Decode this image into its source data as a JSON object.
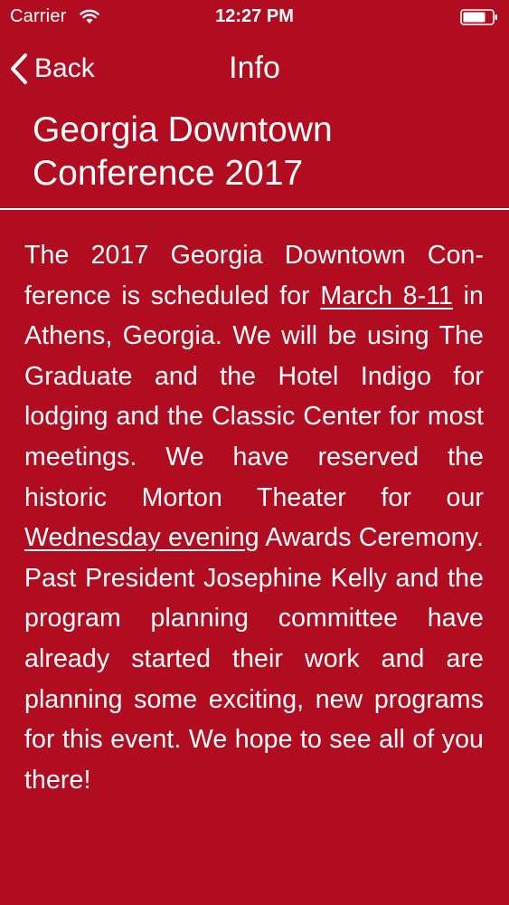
{
  "status_bar": {
    "carrier": "Carrier",
    "time": "12:27 PM",
    "wifi_icon": "wifi-icon",
    "battery_icon": "battery-icon"
  },
  "nav": {
    "back_label": "Back",
    "title": "Info",
    "back_icon": "chevron-left-icon"
  },
  "content": {
    "title_line1": "Georgia Downtown",
    "title_line2": "Conference 2017",
    "p_part1": "The 2017 Georgia Downtown Con­ference is scheduled for ",
    "link_dates": "March 8-11",
    "p_part2": " in Athens, Georgia. We will be using The Graduate and the Hotel Indigo for lodging and the Classic Center for most meetings. We have reserved the historic Morton The­ater for our ",
    "link_event": "Wednesday evening",
    "p_part3": " Awards Ceremony. Past President Josephine Kelly and the program planning committee have already started their work and are planning some exciting, new programs for this event. We hope to see all of you there!"
  },
  "colors": {
    "background": "#B10C1F",
    "text": "#FFFFFF"
  }
}
